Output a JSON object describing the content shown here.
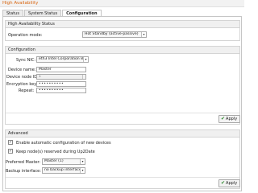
{
  "app": {
    "title": "High Availability"
  },
  "tabs": [
    {
      "label": "Status"
    },
    {
      "label": "System Status"
    },
    {
      "label": "Configuration"
    }
  ],
  "status_panel": {
    "header": "High Availability Status",
    "operation_mode_label": "Operation mode:",
    "operation_mode_value": "Hot Standby (active-passive)"
  },
  "config_panel": {
    "header": "Configuration",
    "sync_nic_label": "Sync NIC:",
    "sync_nic_value": "eth3 Intel Corporation 82",
    "device_name_label": "Device name:",
    "device_name_value": "Master",
    "device_node_id_label": "Device node ID:",
    "device_node_id_value": "1",
    "encryption_key_label": "Encryption key:",
    "encryption_key_value": "••••••••••",
    "repeat_label": "Repeat:",
    "repeat_value": "••••••••••",
    "apply_label": "Apply"
  },
  "advanced_panel": {
    "header": "Advanced",
    "auto_config_label": "Enable automatic configuration of new devices",
    "auto_config_checked": true,
    "keep_nodes_label": "Keep node(s) reserved during Up2Date",
    "keep_nodes_checked": true,
    "preferred_master_label": "Preferred Master:",
    "preferred_master_value": "Master (1)",
    "backup_interface_label": "Backup interface:",
    "backup_interface_value": "no backup interface",
    "apply_label": "Apply"
  },
  "icons": {
    "apply": "check-icon",
    "dropdown": "chevron-down-icon"
  },
  "colors": {
    "title": "#d8650f",
    "apply_check": "#2e8b2e"
  }
}
